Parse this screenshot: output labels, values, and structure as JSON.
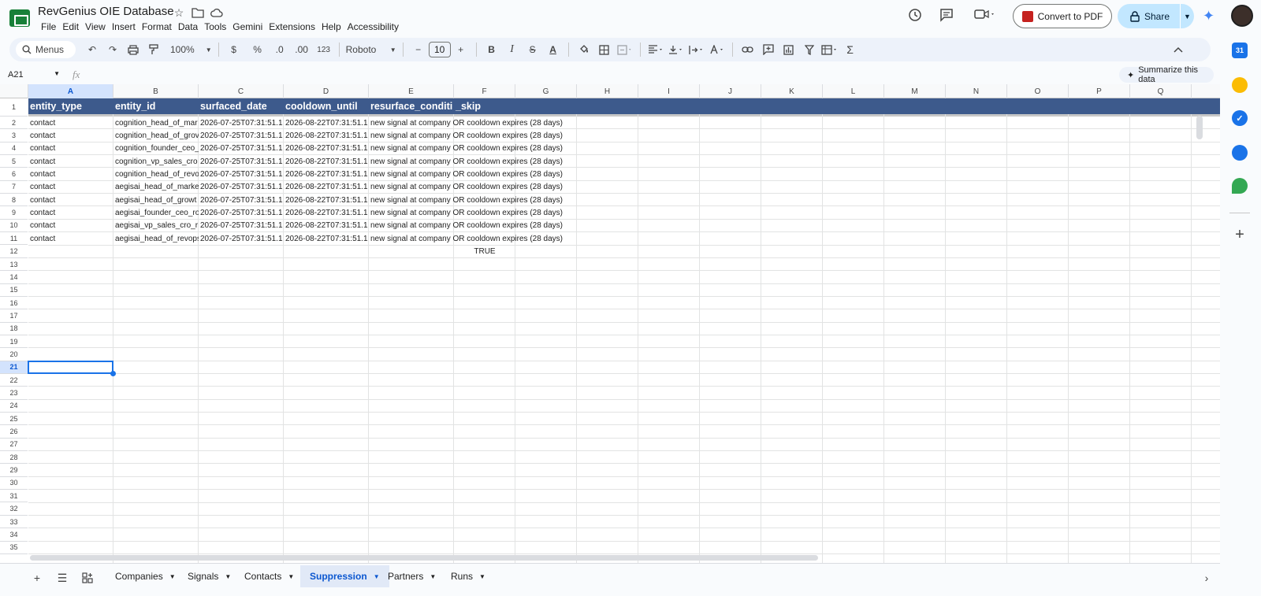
{
  "document": {
    "title": "RevGenius OIE Database"
  },
  "menubar": [
    "File",
    "Edit",
    "View",
    "Insert",
    "Format",
    "Data",
    "Tools",
    "Gemini",
    "Extensions",
    "Help",
    "Accessibility"
  ],
  "header": {
    "convert_pdf": "Convert to PDF",
    "share": "Share"
  },
  "toolbar": {
    "menus": "Menus",
    "zoom": "100%",
    "currency": "$",
    "percent": "%",
    "dec_decrease": ".0",
    "dec_increase": ".00",
    "number_format": "123",
    "font": "Roboto",
    "font_size": "10"
  },
  "formula_bar": {
    "cell_ref": "A21",
    "fx": "fx",
    "summarize": "Summarize this data"
  },
  "columns": [
    "A",
    "B",
    "C",
    "D",
    "E",
    "F",
    "G",
    "H",
    "I",
    "J",
    "K",
    "L",
    "M",
    "N",
    "O",
    "P",
    "Q"
  ],
  "header_row": [
    "entity_type",
    "entity_id",
    "surfaced_date",
    "cooldown_until",
    "resurface_conditi",
    "_skip"
  ],
  "rows": [
    [
      "contact",
      "cognition_head_of_mar",
      "2026-07-25T07:31:51.1",
      "2026-08-22T07:31:51.1",
      "new signal at company OR cooldown expires (28 days)"
    ],
    [
      "contact",
      "cognition_head_of_grov",
      "2026-07-25T07:31:51.1",
      "2026-08-22T07:31:51.1",
      "new signal at company OR cooldown expires (28 days)"
    ],
    [
      "contact",
      "cognition_founder_ceo_",
      "2026-07-25T07:31:51.1",
      "2026-08-22T07:31:51.1",
      "new signal at company OR cooldown expires (28 days)"
    ],
    [
      "contact",
      "cognition_vp_sales_cro",
      "2026-07-25T07:31:51.1",
      "2026-08-22T07:31:51.1",
      "new signal at company OR cooldown expires (28 days)"
    ],
    [
      "contact",
      "cognition_head_of_revo",
      "2026-07-25T07:31:51.1",
      "2026-08-22T07:31:51.1",
      "new signal at company OR cooldown expires (28 days)"
    ],
    [
      "contact",
      "aegisai_head_of_marke",
      "2026-07-25T07:31:51.1",
      "2026-08-22T07:31:51.1",
      "new signal at company OR cooldown expires (28 days)"
    ],
    [
      "contact",
      "aegisai_head_of_growt",
      "2026-07-25T07:31:51.1",
      "2026-08-22T07:31:51.1",
      "new signal at company OR cooldown expires (28 days)"
    ],
    [
      "contact",
      "aegisai_founder_ceo_ro",
      "2026-07-25T07:31:51.1",
      "2026-08-22T07:31:51.1",
      "new signal at company OR cooldown expires (28 days)"
    ],
    [
      "contact",
      "aegisai_vp_sales_cro_r",
      "2026-07-25T07:31:51.1",
      "2026-08-22T07:31:51.1",
      "new signal at company OR cooldown expires (28 days)"
    ],
    [
      "contact",
      "aegisai_head_of_revops",
      "2026-07-25T07:31:51.1",
      "2026-08-22T07:31:51.1",
      "new signal at company OR cooldown expires (28 days)"
    ]
  ],
  "row12_f": "TRUE",
  "row_numbers": [
    "1",
    "2",
    "3",
    "4",
    "5",
    "6",
    "7",
    "8",
    "9",
    "10",
    "11",
    "12",
    "13",
    "14",
    "15",
    "16",
    "17",
    "18",
    "19",
    "20",
    "21",
    "22",
    "23",
    "24",
    "25",
    "26",
    "27",
    "28",
    "29",
    "30",
    "31",
    "32",
    "33",
    "34",
    "35"
  ],
  "selected_row": "21",
  "tabs": [
    "Companies",
    "Signals",
    "Contacts",
    "Suppression",
    "Partners",
    "Runs"
  ],
  "active_tab": "Suppression",
  "colors": {
    "header_fill": "#3d5a8c",
    "accent": "#0b57d0",
    "selection": "#1a73e8"
  }
}
